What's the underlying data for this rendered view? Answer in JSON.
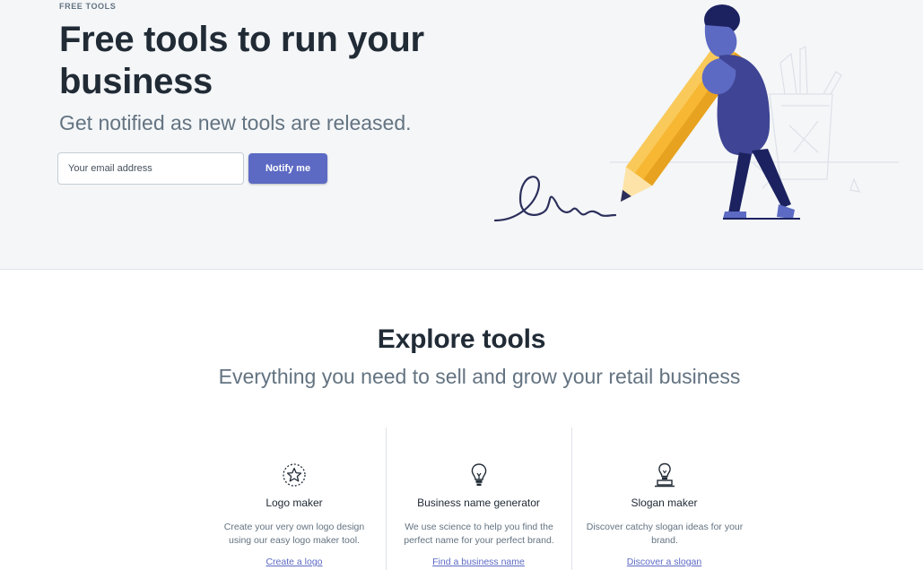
{
  "hero": {
    "eyebrow": "FREE TOOLS",
    "title": "Free tools to run your business",
    "subtitle": "Get notified as new tools are released.",
    "email_placeholder": "Your email address",
    "notify_label": "Notify me"
  },
  "explore": {
    "title": "Explore tools",
    "subtitle": "Everything you need to sell and grow your retail business"
  },
  "tools": [
    {
      "name": "Logo maker",
      "description": "Create your very own logo design using our easy logo maker tool.",
      "link": "Create a logo",
      "icon": "star-badge-icon"
    },
    {
      "name": "Business name generator",
      "description": "We use science to help you find the perfect name for your perfect brand.",
      "link": "Find a business name",
      "icon": "lightbulb-icon"
    },
    {
      "name": "Slogan maker",
      "description": "Discover catchy slogan ideas for your brand.",
      "link": "Discover a slogan",
      "icon": "lightbulb-stand-icon"
    }
  ],
  "colors": {
    "hero_bg": "#f4f6f8",
    "accent": "#5c6ac4",
    "heading": "#212b36",
    "muted": "#637381",
    "pencil": "#f7b733"
  }
}
